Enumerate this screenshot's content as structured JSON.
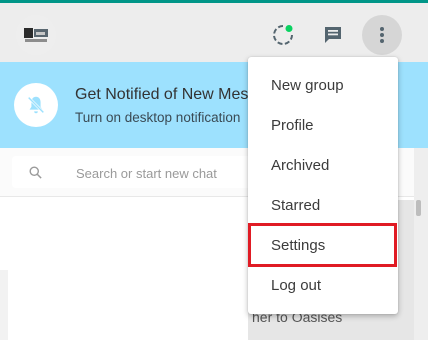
{
  "header": {
    "profile_avatar": "avatar",
    "icons": {
      "status": "status-icon",
      "new_chat": "chat-icon",
      "menu": "more-vertical-icon"
    }
  },
  "notification": {
    "title": "Get Notified of New Mes",
    "subtitle": "Turn on desktop notification",
    "icon": "bell-off-icon"
  },
  "search": {
    "placeholder": "Search or start new chat",
    "icon": "search-icon"
  },
  "menu": {
    "items": [
      {
        "label": "New group"
      },
      {
        "label": "Profile"
      },
      {
        "label": "Archived"
      },
      {
        "label": "Starred"
      },
      {
        "label": "Settings"
      },
      {
        "label": "Log out"
      }
    ],
    "highlighted": "Settings"
  },
  "background_panel": {
    "text": "her to Oasises"
  },
  "colors": {
    "header_bg": "#ededed",
    "teal_accent": "#009688",
    "status_dot": "#09d261",
    "notification_bg": "#9de1fe",
    "highlight_border": "#e01b24"
  }
}
